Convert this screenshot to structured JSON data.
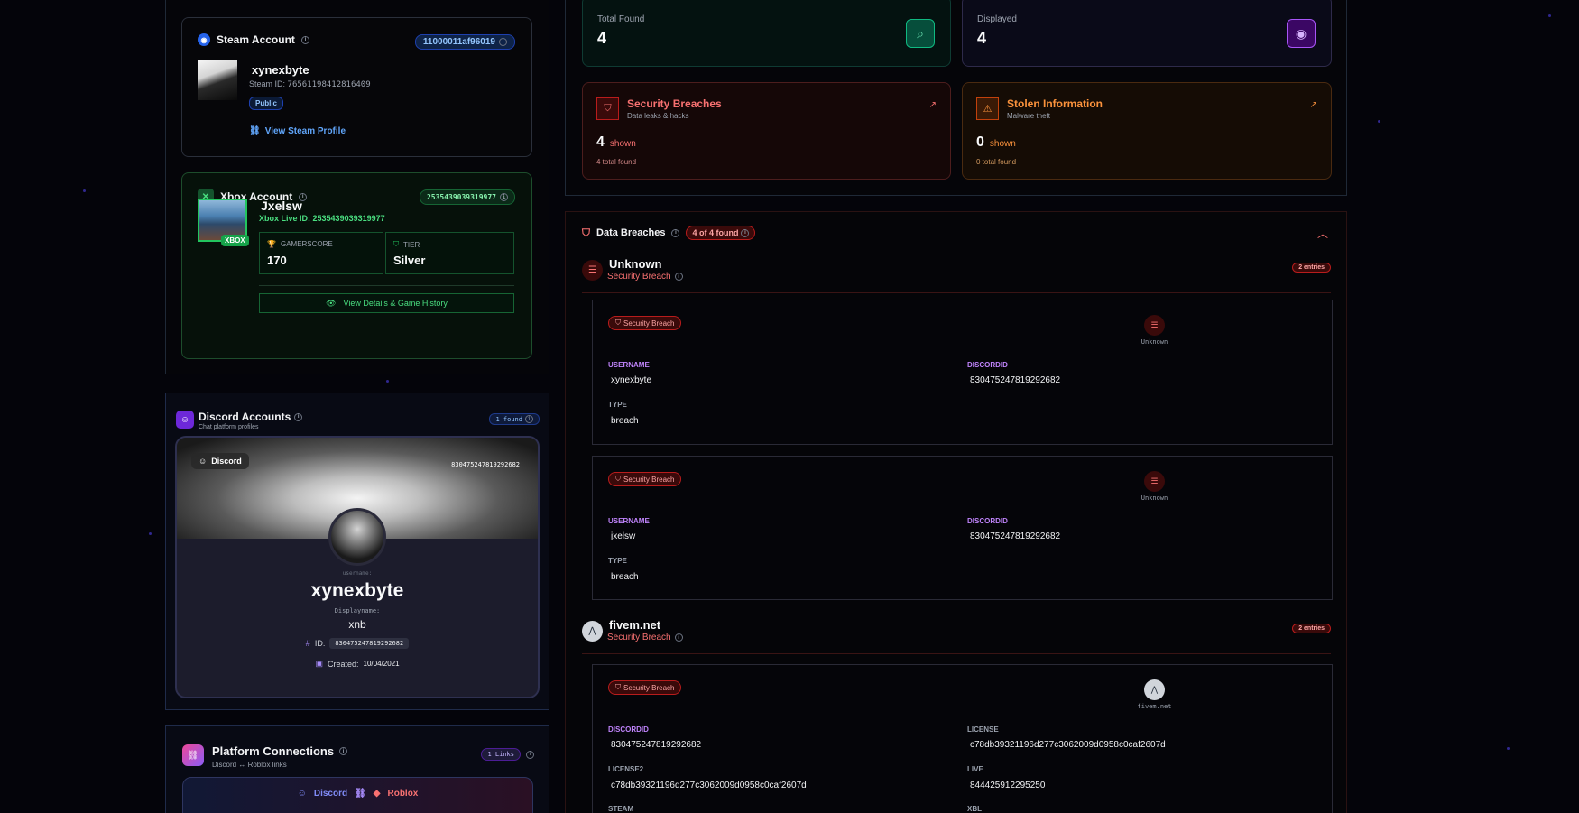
{
  "steam": {
    "title": "Steam Account",
    "id_pill": "11000011af96019",
    "name": "xynexbyte",
    "steam_id_label": "Steam ID:",
    "steam_id": "76561198412816409",
    "visibility": "Public",
    "link": "View Steam Profile"
  },
  "xbox": {
    "title": "Xbox Account",
    "id_pill": "2535439039319977",
    "tag": "XBOX",
    "name": "Jxelsw",
    "live_id_label": "Xbox Live ID:",
    "live_id": "2535439039319977",
    "gamerscore_label": "GAMERSCORE",
    "gamerscore": "170",
    "tier_label": "TIER",
    "tier": "Silver",
    "details_button": "View Details & Game History"
  },
  "discord": {
    "title": "Discord Accounts",
    "subtitle": "Chat platform profiles",
    "found": "1 found",
    "chip": "Discord",
    "banner_id": "830475247819292682",
    "username_label": "username:",
    "username": "xynexbyte",
    "displayname_label": "Displayname:",
    "displayname": "xnb",
    "id_label": "ID:",
    "id": "830475247819292682",
    "created_label": "Created:",
    "created": "10/04/2021"
  },
  "platform": {
    "title": "Platform Connections",
    "subtitle": "Discord ↔ Roblox links",
    "links": "1 Links",
    "from": "Discord",
    "to": "Roblox"
  },
  "stats": {
    "total_label": "Total Found",
    "total": "4",
    "displayed_label": "Displayed",
    "displayed": "4"
  },
  "breach_card": {
    "title": "Security Breaches",
    "sub": "Data leaks & hacks",
    "count": "4",
    "shown": "shown",
    "total": "4 total found"
  },
  "stolen_card": {
    "title": "Stolen Information",
    "sub": "Malware theft",
    "count": "0",
    "shown": "shown",
    "total": "0 total found"
  },
  "breaches": {
    "title": "Data Breaches",
    "count": "4 of 4 found",
    "sources": [
      {
        "name": "Unknown",
        "type": "Security Breach",
        "entries": "2 entries",
        "records": [
          {
            "badge": "Security Breach",
            "source": "Unknown",
            "f1_label": "USERNAME",
            "f1": "xynexbyte",
            "f2_label": "DISCORDID",
            "f2": "830475247819292682",
            "f3_label": "TYPE",
            "f3": "breach"
          },
          {
            "badge": "Security Breach",
            "source": "Unknown",
            "f1_label": "USERNAME",
            "f1": "jxelsw",
            "f2_label": "DISCORDID",
            "f2": "830475247819292682",
            "f3_label": "TYPE",
            "f3": "breach"
          }
        ]
      },
      {
        "name": "fivem.net",
        "type": "Security Breach",
        "entries": "2 entries",
        "records": [
          {
            "badge": "Security Breach",
            "source": "fivem.net",
            "f1_label": "DISCORDID",
            "f1": "830475247819292682",
            "f2_label": "LICENSE",
            "f2": "c78db39321196d277c3062009d0958c0caf2607d",
            "f3_label": "LICENSE2",
            "f3": "c78db39321196d277c3062009d0958c0caf2607d",
            "f4_label": "LIVE",
            "f4": "844425912295250",
            "f5_label": "STEAM",
            "f6_label": "XBL"
          }
        ]
      }
    ]
  }
}
